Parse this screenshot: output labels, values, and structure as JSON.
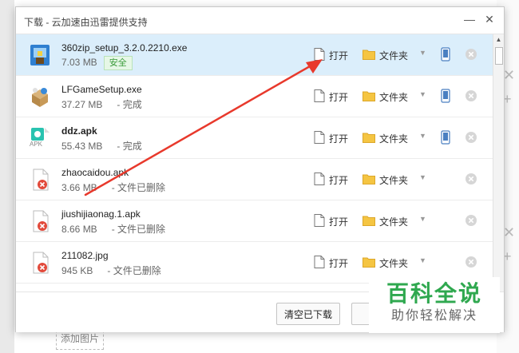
{
  "background": {
    "add_image_label": "添加图片"
  },
  "dialog": {
    "title": "下载 - 云加速由迅雷提供支持",
    "minimize_glyph": "—",
    "close_glyph": "✕"
  },
  "actions": {
    "open_label": "打开",
    "folder_label": "文件夹",
    "dropdown_glyph": "▼"
  },
  "downloads": [
    {
      "name": "360zip_setup_3.2.0.2210.exe",
      "size": "7.03 MB",
      "badge": "安全",
      "status": "",
      "icon": "installer-icon",
      "phone": true
    },
    {
      "name": "LFGameSetup.exe",
      "size": "37.27 MB",
      "badge": "",
      "status": "- 完成",
      "icon": "setup-box-icon",
      "phone": true
    },
    {
      "name": "ddz.apk",
      "size": "55.43 MB",
      "badge": "",
      "status": "- 完成",
      "icon": "apk-icon",
      "apk_label": "APK",
      "phone": true
    },
    {
      "name": "zhaocaidou.apk",
      "size": "3.66 MB",
      "badge": "",
      "status": "- 文件已删除",
      "icon": "missing-file-icon",
      "phone": false
    },
    {
      "name": "jiushijiaonag.1.apk",
      "size": "8.66 MB",
      "badge": "",
      "status": "- 文件已删除",
      "icon": "missing-file-icon",
      "phone": false
    },
    {
      "name": "211082.jpg",
      "size": "945 KB",
      "badge": "",
      "status": "- 文件已删除",
      "icon": "missing-file-icon",
      "phone": false
    }
  ],
  "footer": {
    "clear_label": "清空已下载"
  },
  "watermark": {
    "main": "百科全说",
    "sub": "助你轻松解决"
  },
  "colors": {
    "selected_row": "#dbeefb",
    "arrow": "#e8392c",
    "watermark_green": "#2fa84f",
    "folder_yellow": "#f5c542"
  }
}
